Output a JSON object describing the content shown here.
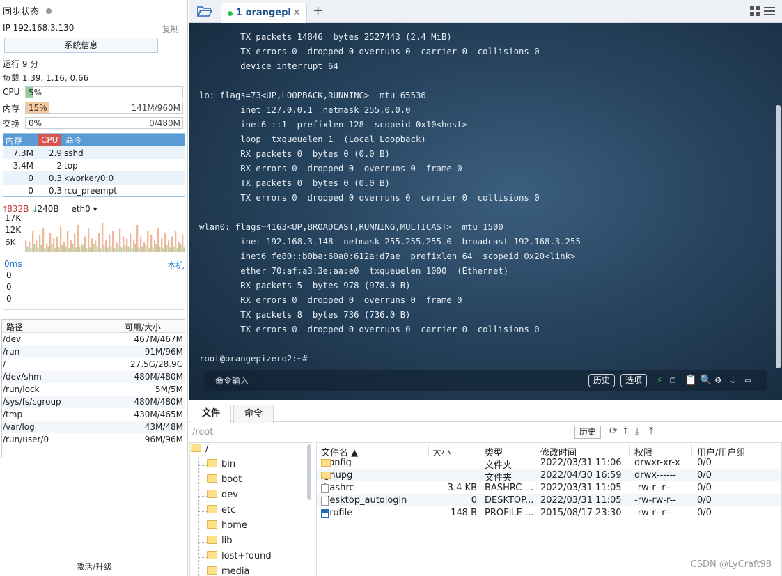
{
  "sidebar": {
    "sync_label": "同步状态",
    "ip": "IP 192.168.3.130",
    "copy": "复制",
    "sysinfo_button": "系统信息",
    "uptime": "运行 9 分",
    "load": "负载 1.39, 1.16, 0.66",
    "cpu": {
      "label": "CPU",
      "percent": "5%",
      "fill": 0.05,
      "color": "#8fd19e"
    },
    "mem": {
      "label": "内存",
      "percent": "15%",
      "amount": "141M/960M",
      "fill": 0.15,
      "color": "#f6c89f"
    },
    "swap": {
      "label": "交换",
      "percent": "0%",
      "amount": "0/480M",
      "fill": 0,
      "color": "#cccccc"
    },
    "proc_header": {
      "mem": "内存",
      "cpu": "CPU",
      "cmd": "命令"
    },
    "processes": [
      {
        "mem": "7.3M",
        "cpu": "2.9",
        "cmd": "sshd"
      },
      {
        "mem": "3.4M",
        "cpu": "2",
        "cmd": "top"
      },
      {
        "mem": "0",
        "cpu": "0.3",
        "cmd": "kworker/0:0"
      },
      {
        "mem": "0",
        "cpu": "0.3",
        "cmd": "rcu_preempt"
      }
    ],
    "net": {
      "up": "832B",
      "down": "240B",
      "iface": "eth0"
    },
    "net_axis": [
      "17K",
      "12K",
      "6K"
    ],
    "ping": {
      "ms": "0ms",
      "host": "本机",
      "values": [
        "0",
        "0",
        "0"
      ]
    },
    "disk_header": {
      "path": "路径",
      "size": "可用/大小"
    },
    "disks": [
      {
        "path": "/dev",
        "size": "467M/467M"
      },
      {
        "path": "/run",
        "size": "91M/96M"
      },
      {
        "path": "/",
        "size": "27.5G/28.9G"
      },
      {
        "path": "/dev/shm",
        "size": "480M/480M"
      },
      {
        "path": "/run/lock",
        "size": "5M/5M"
      },
      {
        "path": "/sys/fs/cgroup",
        "size": "480M/480M"
      },
      {
        "path": "/tmp",
        "size": "430M/465M"
      },
      {
        "path": "/var/log",
        "size": "43M/48M"
      },
      {
        "path": "/run/user/0",
        "size": "96M/96M"
      }
    ],
    "activate": "激活/升级"
  },
  "tabs": {
    "active_label": "1 orangepi"
  },
  "terminal": {
    "lines": [
      "        TX packets 14846  bytes 2527443 (2.4 MiB)",
      "        TX errors 0  dropped 0 overruns 0  carrier 0  collisions 0",
      "        device interrupt 64",
      "",
      "lo: flags=73<UP,LOOPBACK,RUNNING>  mtu 65536",
      "        inet 127.0.0.1  netmask 255.0.0.0",
      "        inet6 ::1  prefixlen 128  scopeid 0x10<host>",
      "        loop  txqueuelen 1  (Local Loopback)",
      "        RX packets 0  bytes 0 (0.0 B)",
      "        RX errors 0  dropped 0  overruns 0  frame 0",
      "        TX packets 0  bytes 0 (0.0 B)",
      "        TX errors 0  dropped 0 overruns 0  carrier 0  collisions 0",
      "",
      "wlan0: flags=4163<UP,BROADCAST,RUNNING,MULTICAST>  mtu 1500",
      "        inet 192.168.3.148  netmask 255.255.255.0  broadcast 192.168.3.255",
      "        inet6 fe80::b0ba:60a0:612a:d7ae  prefixlen 64  scopeid 0x20<link>",
      "        ether 70:af:a3:3e:aa:e0  txqueuelen 1000  (Ethernet)",
      "        RX packets 5  bytes 978 (978.0 B)",
      "        RX errors 0  dropped 0  overruns 0  frame 0",
      "        TX packets 8  bytes 736 (736.0 B)",
      "        TX errors 0  dropped 0 overruns 0  carrier 0  collisions 0",
      "",
      "root@orangepizero2:~#"
    ],
    "command_placeholder": "命令输入",
    "history_btn": "历史",
    "options_btn": "选项"
  },
  "lower": {
    "tab_files": "文件",
    "tab_commands": "命令",
    "path": "/root",
    "history_btn": "历史",
    "tree": [
      "/",
      "bin",
      "boot",
      "dev",
      "etc",
      "home",
      "lib",
      "lost+found",
      "media"
    ],
    "file_header": {
      "name": "文件名 ▲",
      "size": "大小",
      "type": "类型",
      "mtime": "修改时间",
      "perm": "权限",
      "owner": "用户/用户组"
    },
    "files": [
      {
        "name": ".config",
        "size": "",
        "type": "文件夹",
        "mtime": "2022/03/31 11:06",
        "perm": "drwxr-xr-x",
        "owner": "0/0",
        "icon": "folder"
      },
      {
        "name": ".gnupg",
        "size": "",
        "type": "文件夹",
        "mtime": "2022/04/30 16:59",
        "perm": "drwx------",
        "owner": "0/0",
        "icon": "folder"
      },
      {
        "name": ".bashrc",
        "size": "3.4 KB",
        "type": "BASHRC ...",
        "mtime": "2022/03/31 11:05",
        "perm": "-rw-r--r--",
        "owner": "0/0",
        "icon": "file"
      },
      {
        "name": ".desktop_autologin",
        "size": "0",
        "type": "DESKTOP...",
        "mtime": "2022/03/31 11:05",
        "perm": "-rw-rw-r--",
        "owner": "0/0",
        "icon": "file"
      },
      {
        "name": ".profile",
        "size": "148 B",
        "type": "PROFILE ...",
        "mtime": "2015/08/17 23:30",
        "perm": "-rw-r--r--",
        "owner": "0/0",
        "icon": "profile"
      }
    ],
    "watermark": "CSDN @LyCraft98"
  },
  "net_chart_data": {
    "type": "bar",
    "upload": [
      0.3,
      0.25,
      0.55,
      0.3,
      0.45,
      0.6,
      0.2,
      0.5,
      0.35,
      0.4,
      0.65,
      0.25,
      0.55,
      0.3,
      0.5,
      0.7,
      0.2,
      0.4,
      0.6,
      0.35,
      0.3,
      0.5,
      0.75,
      0.3,
      0.45,
      0.55,
      0.25,
      0.6,
      0.4,
      0.35,
      0.5,
      0.3,
      0.7,
      0.4,
      0.25,
      0.55,
      0.45,
      0.3,
      0.6,
      0.35,
      0.5,
      0.3,
      0.4,
      0.55,
      0.25,
      0.45
    ],
    "download": [
      0.15,
      0.1,
      0.2,
      0.12,
      0.18,
      0.1,
      0.15,
      0.2,
      0.1,
      0.12,
      0.18,
      0.15,
      0.1,
      0.2,
      0.12,
      0.15,
      0.18,
      0.1,
      0.12,
      0.2,
      0.15,
      0.1,
      0.18,
      0.12,
      0.15,
      0.1,
      0.2,
      0.12,
      0.18,
      0.15,
      0.1,
      0.2,
      0.12,
      0.15,
      0.18,
      0.1,
      0.12,
      0.2,
      0.15,
      0.1,
      0.18,
      0.12,
      0.15,
      0.1,
      0.2,
      0.12
    ],
    "up_color": "#f0b79a",
    "down_color": "#a8d5a2"
  }
}
